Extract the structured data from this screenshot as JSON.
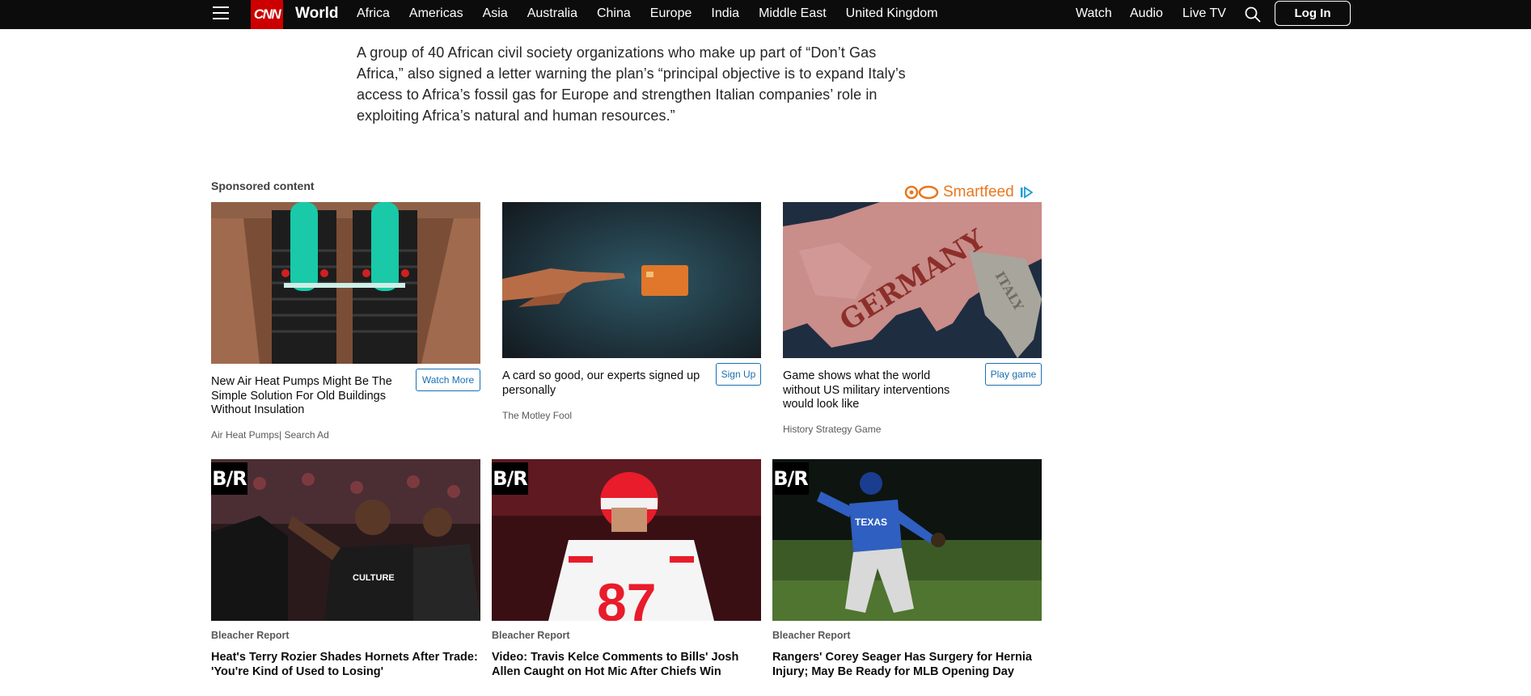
{
  "nav": {
    "logo": "CNN",
    "section": "World",
    "links": [
      "Africa",
      "Americas",
      "Asia",
      "Australia",
      "China",
      "Europe",
      "India",
      "Middle East",
      "United Kingdom"
    ],
    "right_links": [
      "Watch",
      "Audio",
      "Live TV"
    ],
    "login": "Log In"
  },
  "article": {
    "paragraph": "A group of 40 African civil society organizations who make up part of “Don’t Gas Africa,” also signed a letter warning the plan’s “principal objective is to expand Italy’s access to Africa’s fossil gas for Europe and strengthen Italian companies’ role in exploiting Africa’s natural and human resources.”"
  },
  "sponsored": {
    "label": "Sponsored content",
    "provider": "Smartfeed",
    "cards": [
      {
        "title": "New Air Heat Pumps Might Be The Simple Solution For Old Buildings Without Insulation",
        "source": "Air Heat Pumps| Search Ad",
        "cta": "Watch More"
      },
      {
        "title": "A card so good, our experts signed up personally",
        "source": "The Motley Fool",
        "cta": "Sign Up"
      },
      {
        "title": "Game shows what the world without US military interventions would look like",
        "source": "History Strategy Game",
        "cta": "Play game"
      }
    ]
  },
  "bleacher": {
    "badge": "B/R",
    "items": [
      {
        "source": "Bleacher Report",
        "title": "Heat's Terry Rozier Shades Hornets After Trade: 'You're Kind of Used to Losing'"
      },
      {
        "source": "Bleacher Report",
        "title": "Video: Travis Kelce Comments to Bills' Josh Allen Caught on Hot Mic After Chiefs Win"
      },
      {
        "source": "Bleacher Report",
        "title": "Rangers' Corey Seager Has Surgery for Hernia Injury; May Be Ready for MLB Opening Day"
      }
    ]
  },
  "image_text": {
    "map_main": "GERMANY",
    "map_secondary": "ITALY",
    "jersey_number": "87",
    "jersey_team": "TEXAS",
    "shirt_text": "CULTURE"
  },
  "colors": {
    "nav_bg": "#0c0c0c",
    "brand_red": "#cc0000",
    "smartfeed_orange": "#e9771e",
    "cta_blue": "#1a6fb0"
  }
}
